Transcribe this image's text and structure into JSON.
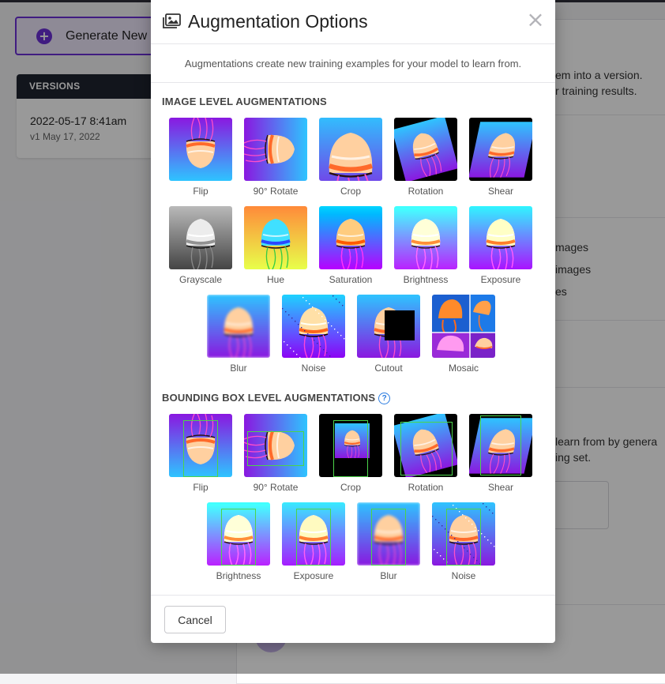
{
  "background": {
    "generate_label": "Generate New",
    "versions_header": "VERSIONS",
    "version_date": "2022-05-17 8:41am",
    "version_sub": "v1 May 17, 2022",
    "text_fragments": [
      "em into a version.",
      "r training results.",
      "mages",
      "images",
      "es",
      "learn from by genera",
      "ing set."
    ]
  },
  "modal": {
    "title": "Augmentation Options",
    "description": "Augmentations create new training examples for your model to learn from.",
    "image_section_title": "IMAGE LEVEL AUGMENTATIONS",
    "bbox_section_title": "BOUNDING BOX LEVEL AUGMENTATIONS",
    "help_glyph": "?",
    "image_level": [
      {
        "label": "Flip",
        "effect": "flip"
      },
      {
        "label": "90° Rotate",
        "effect": "rotate90"
      },
      {
        "label": "Crop",
        "effect": "crop"
      },
      {
        "label": "Rotation",
        "effect": "rotation"
      },
      {
        "label": "Shear",
        "effect": "shear"
      },
      {
        "label": "Grayscale",
        "effect": "grayscale"
      },
      {
        "label": "Hue",
        "effect": "hue"
      },
      {
        "label": "Saturation",
        "effect": "saturation"
      },
      {
        "label": "Brightness",
        "effect": "brightness"
      },
      {
        "label": "Exposure",
        "effect": "exposure"
      },
      {
        "label": "Blur",
        "effect": "blur"
      },
      {
        "label": "Noise",
        "effect": "noise"
      },
      {
        "label": "Cutout",
        "effect": "cutout"
      },
      {
        "label": "Mosaic",
        "effect": "mosaic"
      }
    ],
    "bbox_level": [
      {
        "label": "Flip",
        "effect": "bbox-flip"
      },
      {
        "label": "90° Rotate",
        "effect": "bbox-rotate90"
      },
      {
        "label": "Crop",
        "effect": "bbox-crop"
      },
      {
        "label": "Rotation",
        "effect": "bbox-rotation"
      },
      {
        "label": "Shear",
        "effect": "bbox-shear"
      },
      {
        "label": "Brightness",
        "effect": "bbox-brightness"
      },
      {
        "label": "Exposure",
        "effect": "bbox-exposure"
      },
      {
        "label": "Blur",
        "effect": "bbox-blur"
      },
      {
        "label": "Noise",
        "effect": "bbox-noise"
      }
    ],
    "cancel_label": "Cancel"
  },
  "colors": {
    "accent": "#6b2fd8",
    "jelly_bg_top": "#2ec4ff",
    "jelly_bg_bottom": "#8a18e0",
    "bbox": "#4cd44a"
  },
  "icons": {
    "generate": "plus-circle-icon",
    "modal": "image-gallery-icon",
    "close": "close-icon",
    "help": "help-circle-icon"
  }
}
